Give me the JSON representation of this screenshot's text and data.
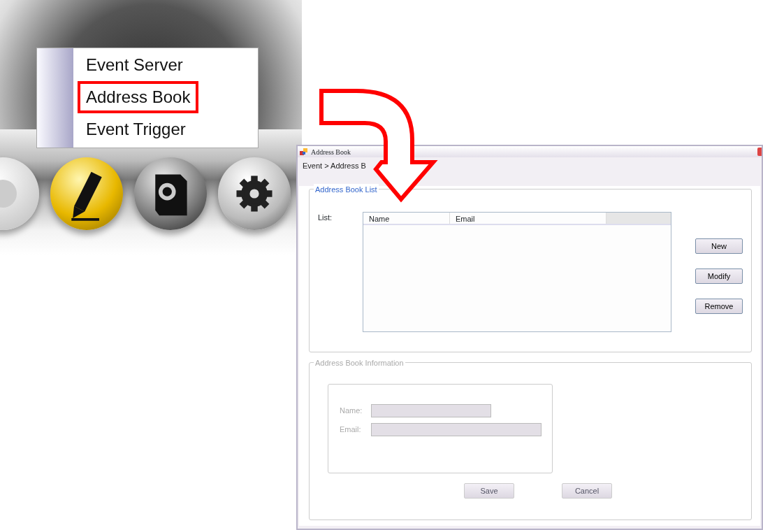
{
  "menu": {
    "items": [
      {
        "label": "Event Server",
        "highlighted": false
      },
      {
        "label": "Address Book",
        "highlighted": true
      },
      {
        "label": "Event Trigger",
        "highlighted": false
      }
    ]
  },
  "toolbar": {
    "buttons": [
      {
        "kind": "partial",
        "selected": false
      },
      {
        "kind": "pencil",
        "selected": true
      },
      {
        "kind": "camera",
        "selected": false
      },
      {
        "kind": "gear",
        "selected": false
      }
    ]
  },
  "window": {
    "title": "Address Book",
    "breadcrumb": "Event > Address B",
    "list_group": {
      "title": "Address Book List",
      "list_label": "List:",
      "columns": [
        "Name",
        "Email"
      ],
      "buttons": [
        "New",
        "Modify",
        "Remove"
      ]
    },
    "info_group": {
      "title": "Address Book Information",
      "disabled": true,
      "fields": [
        {
          "label": "Name:",
          "kind": "short"
        },
        {
          "label": "Email:",
          "kind": "long"
        }
      ],
      "buttons": [
        "Save",
        "Cancel"
      ]
    }
  }
}
